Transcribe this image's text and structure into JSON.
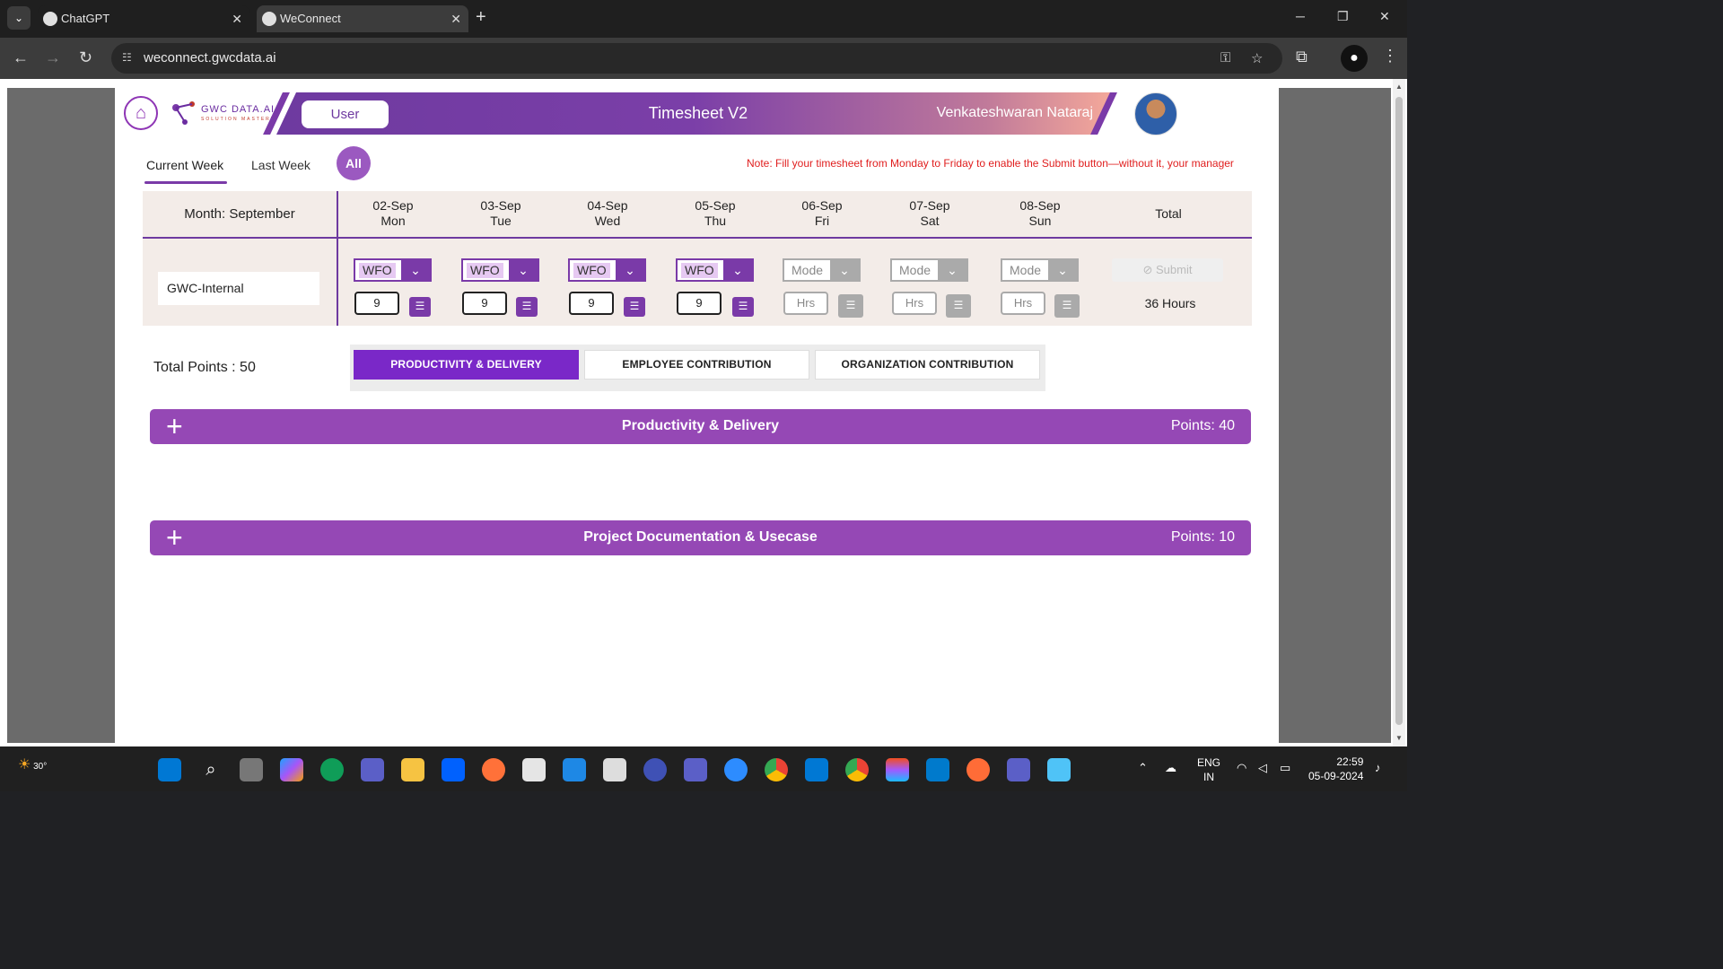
{
  "browser": {
    "tabs": [
      {
        "title": "ChatGPT"
      },
      {
        "title": "WeConnect"
      }
    ],
    "url": "weconnect.gwcdata.ai"
  },
  "header": {
    "logo_text": "GWC DATA.AI",
    "logo_sub": "SOLUTION MASTERY",
    "user_label": "User",
    "title": "Timesheet V2",
    "username": "Venkateshwaran Nataraj"
  },
  "week_tabs": {
    "current": "Current Week",
    "last": "Last Week",
    "all": "All"
  },
  "note": "Note: Fill your timesheet from Monday to Friday to enable the Submit button—without it, your manager",
  "timesheet": {
    "month_label": "Month: September",
    "days": [
      {
        "date": "02-Sep",
        "day": "Mon",
        "mode": "WFO",
        "hours": "9"
      },
      {
        "date": "03-Sep",
        "day": "Tue",
        "mode": "WFO",
        "hours": "9"
      },
      {
        "date": "04-Sep",
        "day": "Wed",
        "mode": "WFO",
        "hours": "9"
      },
      {
        "date": "05-Sep",
        "day": "Thu",
        "mode": "WFO",
        "hours": "9"
      },
      {
        "date": "06-Sep",
        "day": "Fri",
        "mode": "Mode",
        "hours": "Hrs"
      },
      {
        "date": "07-Sep",
        "day": "Sat",
        "mode": "Mode",
        "hours": "Hrs"
      },
      {
        "date": "08-Sep",
        "day": "Sun",
        "mode": "Mode",
        "hours": "Hrs"
      }
    ],
    "total_header": "Total",
    "project": "GWC-Internal",
    "submit_label": "Submit",
    "total_hours": "36 Hours"
  },
  "points": {
    "total_label": "Total Points : 50",
    "categories": [
      "PRODUCTIVITY & DELIVERY",
      "EMPLOYEE CONTRIBUTION",
      "ORGANIZATION CONTRIBUTION"
    ],
    "sections": [
      {
        "title": "Productivity & Delivery",
        "points": "Points: 40"
      },
      {
        "title": "Project Documentation & Usecase",
        "points": "Points: 10"
      }
    ]
  },
  "taskbar": {
    "weather": "30°",
    "lang": "ENG",
    "region": "IN",
    "time": "22:59",
    "date": "05-09-2024"
  },
  "colors": {
    "accent": "#7a3aa8",
    "section": "#9548b5",
    "selected_category": "#7a28c8",
    "note": "#e01e1e"
  }
}
